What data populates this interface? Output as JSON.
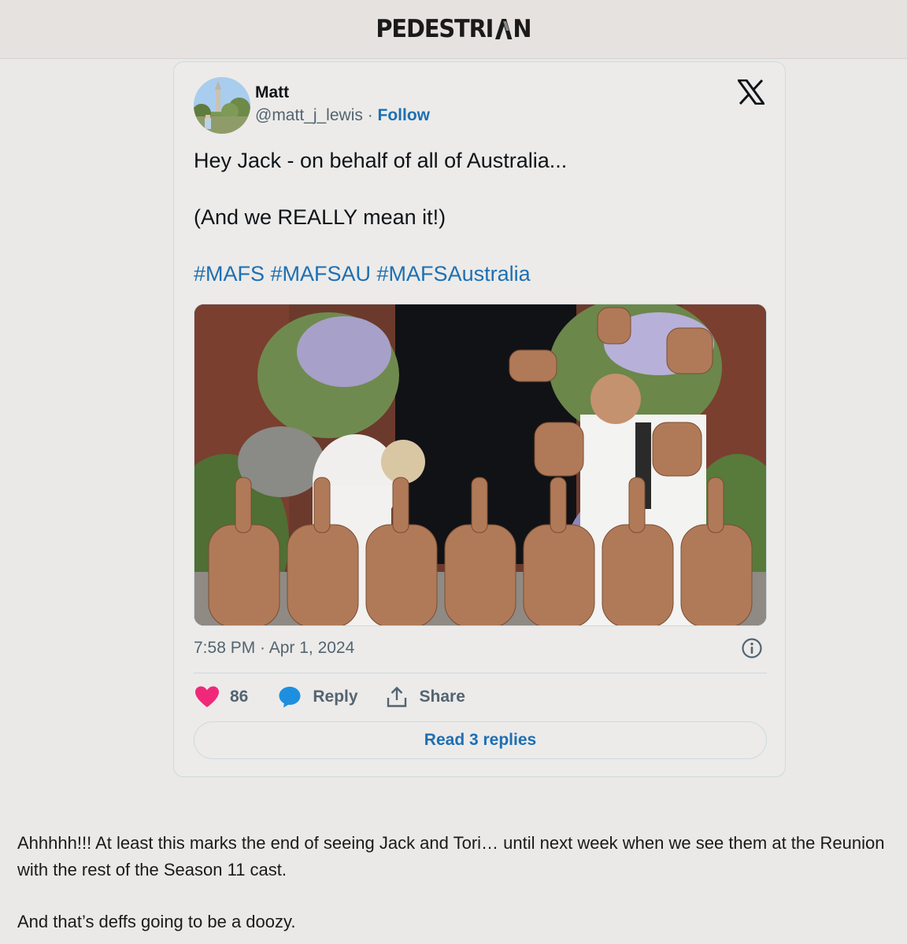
{
  "site": {
    "logo_text": "PEDESTRI",
    "logo_suffix": "N"
  },
  "tweet": {
    "user_name": "Matt",
    "handle": "@matt_j_lewis",
    "separator": " · ",
    "follow_label": "Follow",
    "text_line1": "Hey Jack - on behalf of all of Australia...",
    "text_line2": "(And we REALLY mean it!)",
    "hashtags": "#MAFS #MAFSAU #MAFSAustralia",
    "timestamp": "7:58 PM · Apr 1, 2024",
    "like_count": "86",
    "reply_label": "Reply",
    "share_label": "Share",
    "read_replies_label": "Read 3 replies",
    "colors": {
      "link": "#1d6fb3",
      "heart": "#f0287a",
      "reply_icon": "#1d8fe0",
      "muted": "#536471"
    },
    "icons": [
      "x-logo-icon",
      "info-icon",
      "heart-icon",
      "reply-bubble-icon",
      "share-icon"
    ]
  },
  "article": {
    "paragraph1": "Ahhhhh!!! At least this marks the end of seeing Jack and Tori… until next week when we see them at the Reunion with the rest of the Season 11 cast.",
    "paragraph2": "And that’s deffs going to be a doozy."
  }
}
